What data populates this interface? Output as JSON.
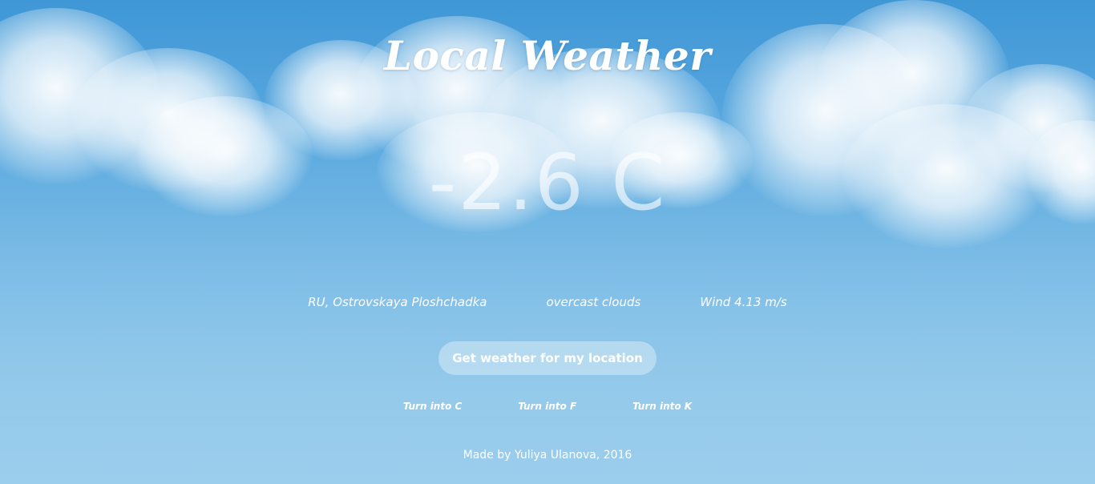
{
  "header": {
    "title": "Local Weather"
  },
  "weather": {
    "temperature": "-2.6 C",
    "location": "RU, Ostrovskaya Ploshchadka",
    "description": "overcast clouds",
    "wind": "Wind 4.13 m/s"
  },
  "actions": {
    "get_weather_label": "Get weather for my location"
  },
  "units": {
    "celsius_label": "Turn into C",
    "fahrenheit_label": "Turn into F",
    "kelvin_label": "Turn into K"
  },
  "footer": {
    "credit": "Made by Yuliya Ulanova, 2016"
  },
  "colors": {
    "sky_top": "#3f97d6",
    "sky_bottom": "#a6d3ee",
    "text": "#ffffff"
  }
}
